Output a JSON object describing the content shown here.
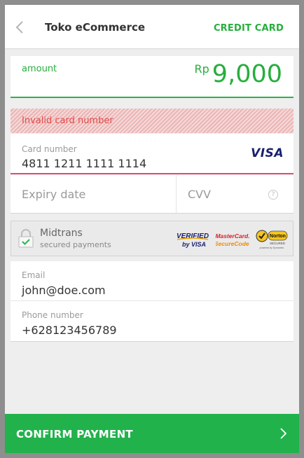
{
  "header": {
    "title": "Toko eCommerce",
    "mode": "CREDIT CARD",
    "back_icon": "chevron-left-icon"
  },
  "amount": {
    "label": "amount",
    "currency": "Rp",
    "value": "9,000"
  },
  "error": {
    "message": "Invalid card number"
  },
  "card_number": {
    "label": "Card number",
    "value": "4811 1211 1111 1114",
    "brand": "VISA"
  },
  "expiry": {
    "placeholder": "Expiry date"
  },
  "cvv": {
    "placeholder": "CVV",
    "help": "?"
  },
  "secure": {
    "title": "Midtrans",
    "subtitle": "secured payments",
    "badges": {
      "vbv_line1": "VERIFIED",
      "vbv_line2": "by VISA",
      "mc_line1": "MasterCard.",
      "mc_line2": "SecureCode.",
      "norton_line1": "Norton",
      "norton_line2": "SECURED",
      "norton_line3": "powered by Symantec"
    }
  },
  "contact": {
    "email_label": "Email",
    "email_value": "john@doe.com",
    "phone_label": "Phone number",
    "phone_value": "+628123456789"
  },
  "confirm": {
    "label": "CONFIRM PAYMENT",
    "icon": "chevron-right-icon"
  },
  "colors": {
    "accent": "#22b24c",
    "error": "#e34a4a",
    "error_underline": "#e0506b",
    "visa_blue": "#1a1f71"
  }
}
